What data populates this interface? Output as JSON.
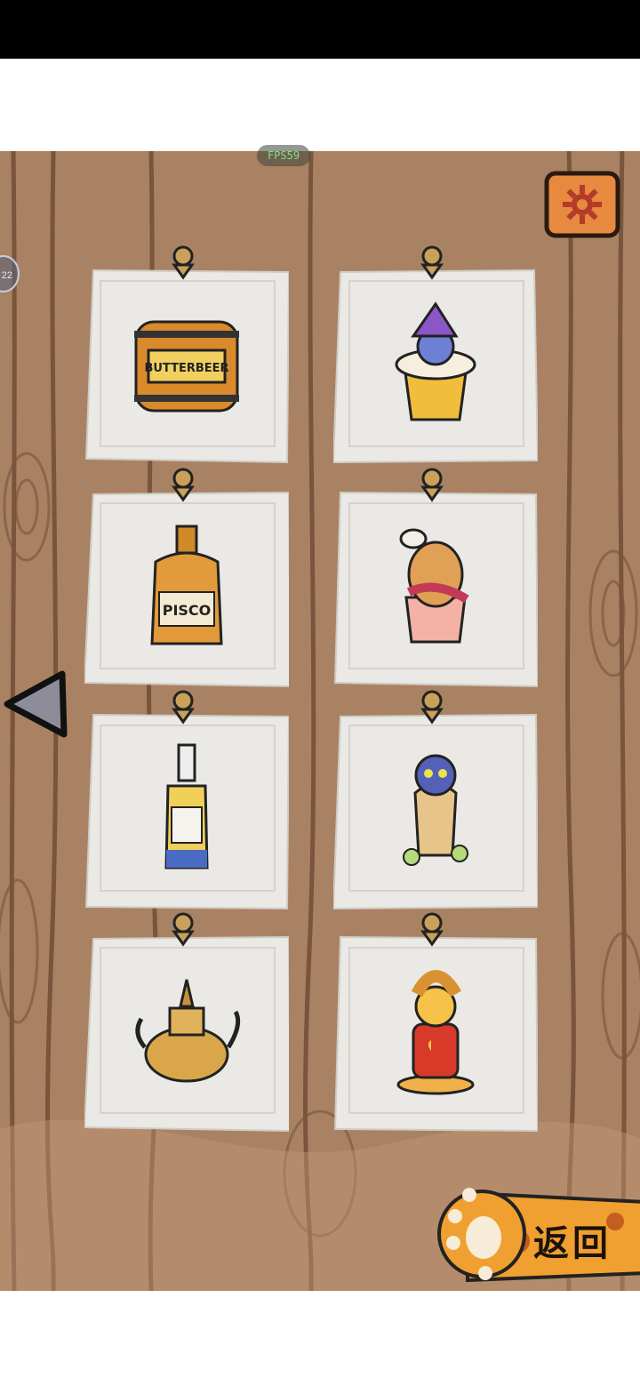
{
  "status_bar": {
    "bg": "#000000"
  },
  "fps_badge": {
    "text": "FPS59"
  },
  "side_badge": {
    "text": "22"
  },
  "settings": {
    "icon": "gear-icon",
    "color": "#e7893f"
  },
  "nav": {
    "prev_icon": "triangle-left-icon"
  },
  "drinks": [
    {
      "name": "butterbeer-barrel",
      "label": "BUTTERBEER"
    },
    {
      "name": "wizard-cat-beer-mug",
      "label": ""
    },
    {
      "name": "pisco-bottle",
      "label": "PISCO"
    },
    {
      "name": "llama-cat-cocktail",
      "label": ""
    },
    {
      "name": "clear-liquor-bottle",
      "label": ""
    },
    {
      "name": "blue-cat-snifter",
      "label": ""
    },
    {
      "name": "golden-teapot",
      "label": ""
    },
    {
      "name": "croissant-cat-drink",
      "label": ""
    }
  ],
  "return_button": {
    "label": "返回",
    "icon": "cat-paw-icon",
    "color": "#f0a030"
  }
}
